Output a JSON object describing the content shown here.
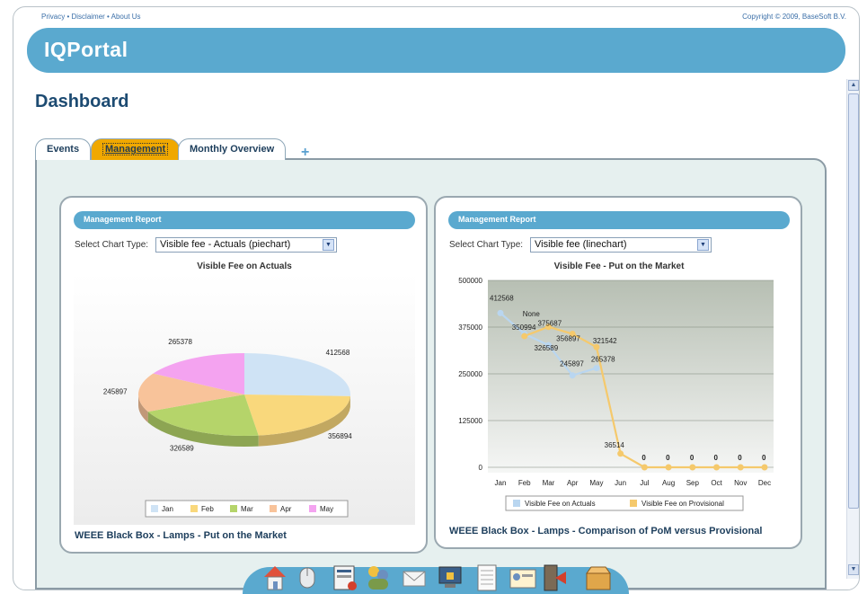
{
  "header": {
    "links": [
      "Privacy",
      "Disclaimer",
      "About Us"
    ],
    "link_sep": " • ",
    "copyright": "Copyright © 2009, BaseSoft B.V.",
    "logo": "IQPortal",
    "page_title": "Dashboard"
  },
  "tabs": [
    {
      "label": "Events",
      "active": false
    },
    {
      "label": "Management",
      "active": true
    },
    {
      "label": "Monthly Overview",
      "active": false
    }
  ],
  "tab_add_symbol": "+",
  "left_panel": {
    "header": "Management Report",
    "select_label": "Select Chart Type:",
    "select_value": "Visible fee - Actuals (piechart)",
    "caption": "WEEE Black Box - Lamps - Put on the Market"
  },
  "right_panel": {
    "header": "Management Report",
    "select_label": "Select Chart Type:",
    "select_value": "Visible fee (linechart)",
    "caption": "WEEE Black Box - Lamps - Comparison of PoM versus Provisional"
  },
  "chart_data": [
    {
      "type": "pie",
      "title": "Visible Fee on Actuals",
      "categories": [
        "Jan",
        "Feb",
        "Mar",
        "Apr",
        "May"
      ],
      "values": [
        412568,
        356894,
        326589,
        245897,
        265378
      ],
      "colors": [
        "#cfe3f5",
        "#f9d87c",
        "#b5d46a",
        "#f8c39a",
        "#f4a3f0"
      ],
      "legend": "bottom"
    },
    {
      "type": "line",
      "title": "Visible Fee - Put on the Market",
      "categories": [
        "Jan",
        "Feb",
        "Mar",
        "Apr",
        "May",
        "Jun",
        "Jul",
        "Aug",
        "Sep",
        "Oct",
        "Nov",
        "Dec"
      ],
      "ylim": [
        0,
        500000
      ],
      "yticks": [
        0,
        125000,
        250000,
        375000,
        500000
      ],
      "series": [
        {
          "name": "Visible Fee on Actuals",
          "color": "#b9d6f0",
          "values": [
            412568,
            356894,
            326589,
            245897,
            265378,
            null,
            null,
            null,
            null,
            null,
            null,
            null
          ]
        },
        {
          "name": "Visible Fee on Provisional",
          "color": "#f5c96c",
          "values": [
            null,
            350994,
            375687,
            356897,
            321542,
            36514,
            0,
            0,
            0,
            0,
            0,
            0
          ]
        }
      ],
      "point_labels": [
        {
          "x": "Jan",
          "text": "412568"
        },
        {
          "x": "Feb",
          "text": "None"
        },
        {
          "x": "Feb",
          "text": "350994"
        },
        {
          "x": "Mar",
          "text": "375687"
        },
        {
          "x": "Mar",
          "text": "326589"
        },
        {
          "x": "Apr",
          "text": "356897"
        },
        {
          "x": "Apr",
          "text": "245897"
        },
        {
          "x": "May",
          "text": "321542"
        },
        {
          "x": "May",
          "text": "265378"
        },
        {
          "x": "Jun",
          "text": "36514"
        },
        {
          "x": "Jul",
          "text": "0"
        },
        {
          "x": "Aug",
          "text": "0"
        },
        {
          "x": "Sep",
          "text": "0"
        },
        {
          "x": "Oct",
          "text": "0"
        },
        {
          "x": "Nov",
          "text": "0"
        },
        {
          "x": "Dec",
          "text": "0"
        }
      ],
      "legend": "bottom",
      "grid": true
    }
  ],
  "taskbar": {
    "icons": [
      "home-icon",
      "mouse-icon",
      "report-icon",
      "users-icon",
      "mail-icon",
      "monitor-icon",
      "document-icon",
      "id-card-icon",
      "logout-icon",
      "box-icon"
    ]
  }
}
